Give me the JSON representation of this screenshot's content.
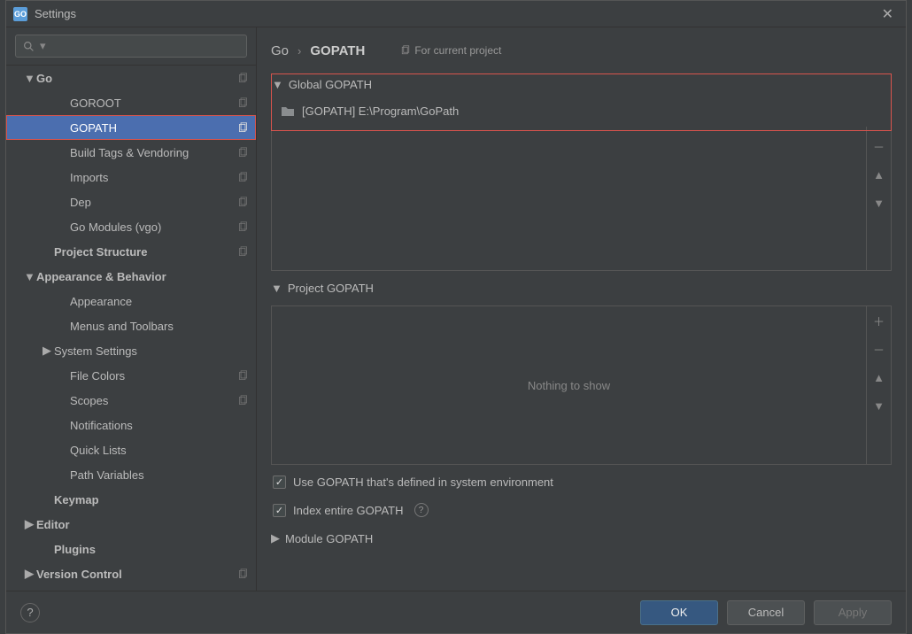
{
  "window": {
    "title": "Settings"
  },
  "search": {
    "placeholder": ""
  },
  "breadcrumb": {
    "root": "Go",
    "current": "GOPATH",
    "for_project": "For current project"
  },
  "sidebar": [
    {
      "label": "Go",
      "depth": 0,
      "bold": true,
      "arrow": "down",
      "copy": true,
      "selected": false
    },
    {
      "label": "GOROOT",
      "depth": 2,
      "bold": false,
      "arrow": "",
      "copy": true,
      "selected": false
    },
    {
      "label": "GOPATH",
      "depth": 2,
      "bold": false,
      "arrow": "",
      "copy": true,
      "selected": true
    },
    {
      "label": "Build Tags & Vendoring",
      "depth": 2,
      "bold": false,
      "arrow": "",
      "copy": true,
      "selected": false
    },
    {
      "label": "Imports",
      "depth": 2,
      "bold": false,
      "arrow": "",
      "copy": true,
      "selected": false
    },
    {
      "label": "Dep",
      "depth": 2,
      "bold": false,
      "arrow": "",
      "copy": true,
      "selected": false
    },
    {
      "label": "Go Modules (vgo)",
      "depth": 2,
      "bold": false,
      "arrow": "",
      "copy": true,
      "selected": false
    },
    {
      "label": "Project Structure",
      "depth": 1,
      "bold": true,
      "arrow": "",
      "copy": true,
      "selected": false
    },
    {
      "label": "Appearance & Behavior",
      "depth": 0,
      "bold": true,
      "arrow": "down",
      "copy": false,
      "selected": false
    },
    {
      "label": "Appearance",
      "depth": 2,
      "bold": false,
      "arrow": "",
      "copy": false,
      "selected": false
    },
    {
      "label": "Menus and Toolbars",
      "depth": 2,
      "bold": false,
      "arrow": "",
      "copy": false,
      "selected": false
    },
    {
      "label": "System Settings",
      "depth": 1,
      "bold": false,
      "arrow": "right",
      "copy": false,
      "selected": false
    },
    {
      "label": "File Colors",
      "depth": 2,
      "bold": false,
      "arrow": "",
      "copy": true,
      "selected": false
    },
    {
      "label": "Scopes",
      "depth": 2,
      "bold": false,
      "arrow": "",
      "copy": true,
      "selected": false
    },
    {
      "label": "Notifications",
      "depth": 2,
      "bold": false,
      "arrow": "",
      "copy": false,
      "selected": false
    },
    {
      "label": "Quick Lists",
      "depth": 2,
      "bold": false,
      "arrow": "",
      "copy": false,
      "selected": false
    },
    {
      "label": "Path Variables",
      "depth": 2,
      "bold": false,
      "arrow": "",
      "copy": false,
      "selected": false
    },
    {
      "label": "Keymap",
      "depth": 1,
      "bold": true,
      "arrow": "",
      "copy": false,
      "selected": false
    },
    {
      "label": "Editor",
      "depth": 0,
      "bold": true,
      "arrow": "right",
      "copy": false,
      "selected": false
    },
    {
      "label": "Plugins",
      "depth": 1,
      "bold": true,
      "arrow": "",
      "copy": false,
      "selected": false
    },
    {
      "label": "Version Control",
      "depth": 0,
      "bold": true,
      "arrow": "right",
      "copy": true,
      "selected": false
    }
  ],
  "sections": {
    "global": {
      "title": "Global GOPATH",
      "entry": "[GOPATH] E:\\Program\\GoPath"
    },
    "project": {
      "title": "Project GOPATH",
      "empty": "Nothing to show"
    },
    "module": {
      "title": "Module GOPATH"
    }
  },
  "checks": {
    "use_system": "Use GOPATH that's defined in system environment",
    "index_entire": "Index entire GOPATH"
  },
  "buttons": {
    "ok": "OK",
    "cancel": "Cancel",
    "apply": "Apply"
  }
}
